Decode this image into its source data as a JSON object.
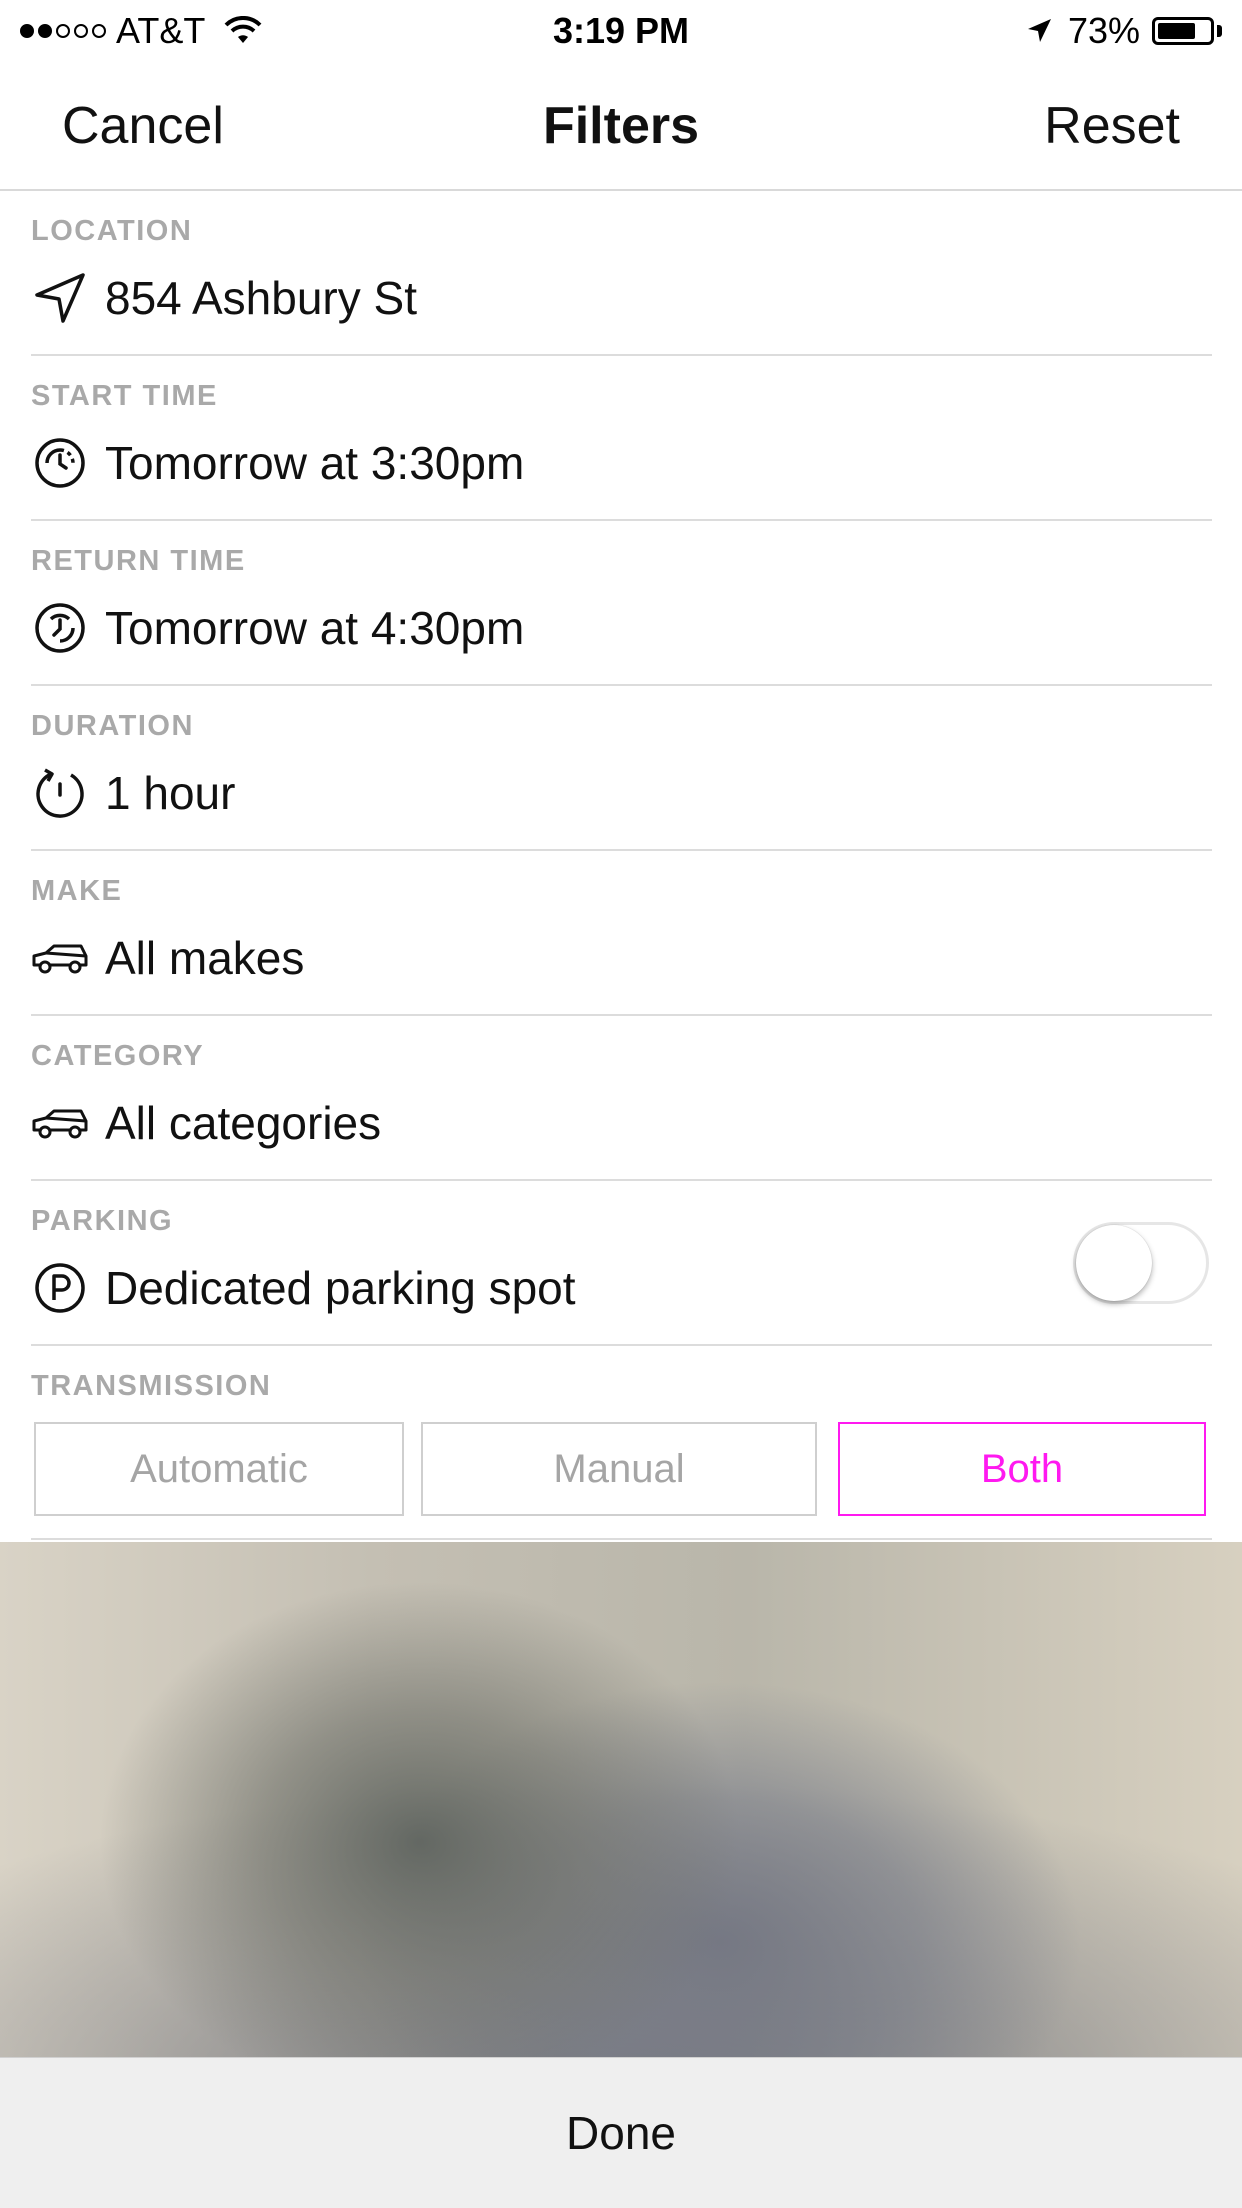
{
  "status_bar": {
    "carrier": "AT&T",
    "signal_bars_filled": 2,
    "signal_bars_total": 5,
    "time": "3:19 PM",
    "battery_percent": "73%",
    "battery_level": 0.73
  },
  "nav": {
    "cancel_label": "Cancel",
    "title": "Filters",
    "reset_label": "Reset"
  },
  "filters": {
    "location": {
      "label": "LOCATION",
      "value": "854 Ashbury St",
      "icon": "navigation-arrow-icon"
    },
    "start_time": {
      "label": "START TIME",
      "value": "Tomorrow at 3:30pm",
      "icon": "clock-icon"
    },
    "return_time": {
      "label": "RETURN TIME",
      "value": "Tomorrow at 4:30pm",
      "icon": "clock-icon"
    },
    "duration": {
      "label": "DURATION",
      "value": "1 hour",
      "icon": "timer-icon"
    },
    "make": {
      "label": "MAKE",
      "value": "All makes",
      "icon": "car-icon"
    },
    "category": {
      "label": "CATEGORY",
      "value": "All categories",
      "icon": "car-icon"
    },
    "parking": {
      "label": "PARKING",
      "value": "Dedicated parking spot",
      "icon": "parking-icon",
      "toggle_on": false
    },
    "transmission": {
      "label": "TRANSMISSION",
      "options": [
        "Automatic",
        "Manual",
        "Both"
      ],
      "selected": "Both"
    }
  },
  "colors": {
    "accent": "#ff19f0",
    "label_gray": "#a9a9a9",
    "divider": "#dcdcdc"
  },
  "footer": {
    "done_label": "Done"
  }
}
